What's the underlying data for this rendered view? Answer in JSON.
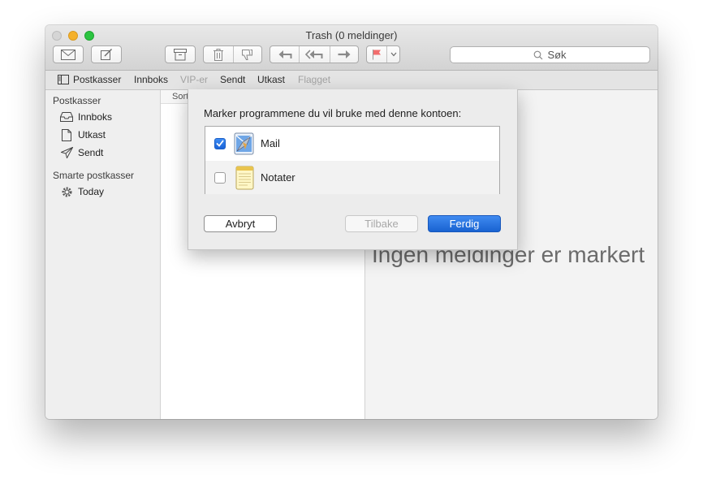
{
  "window": {
    "title": "Trash (0 meldinger)"
  },
  "toolbar": {
    "icons": [
      "envelope-icon",
      "compose-icon",
      "archive-icon",
      "trash-icon",
      "junk-icon",
      "reply-icon",
      "reply-all-icon",
      "forward-icon",
      "flag-icon",
      "chevron-down-icon",
      "search-icon"
    ],
    "search_placeholder": "Søk"
  },
  "favorites": {
    "mailboxes_label": "Postkasser",
    "items": [
      "Innboks",
      "VIP-er",
      "Sendt",
      "Utkast",
      "Flagget"
    ]
  },
  "sidebar": {
    "section1": "Postkasser",
    "items": [
      {
        "label": "Innboks",
        "icon": "inbox-icon"
      },
      {
        "label": "Utkast",
        "icon": "draft-icon"
      },
      {
        "label": "Sendt",
        "icon": "sent-icon"
      }
    ],
    "section2": "Smarte postkasser",
    "smart_items": [
      {
        "label": "Today",
        "icon": "gear-icon"
      }
    ]
  },
  "message_list": {
    "sort_label": "Sort"
  },
  "preview": {
    "empty_text": "Ingen meldinger er markert"
  },
  "sheet": {
    "prompt": "Marker programmene du vil bruke med denne kontoen:",
    "apps": [
      {
        "name": "Mail",
        "checked": true,
        "icon": "mail-app-icon"
      },
      {
        "name": "Notater",
        "checked": false,
        "icon": "notes-app-icon"
      }
    ],
    "cancel": "Avbryt",
    "back": "Tilbake",
    "done": "Ferdig"
  },
  "colors": {
    "accent": "#1963d1",
    "flag": "#f26d6d"
  }
}
